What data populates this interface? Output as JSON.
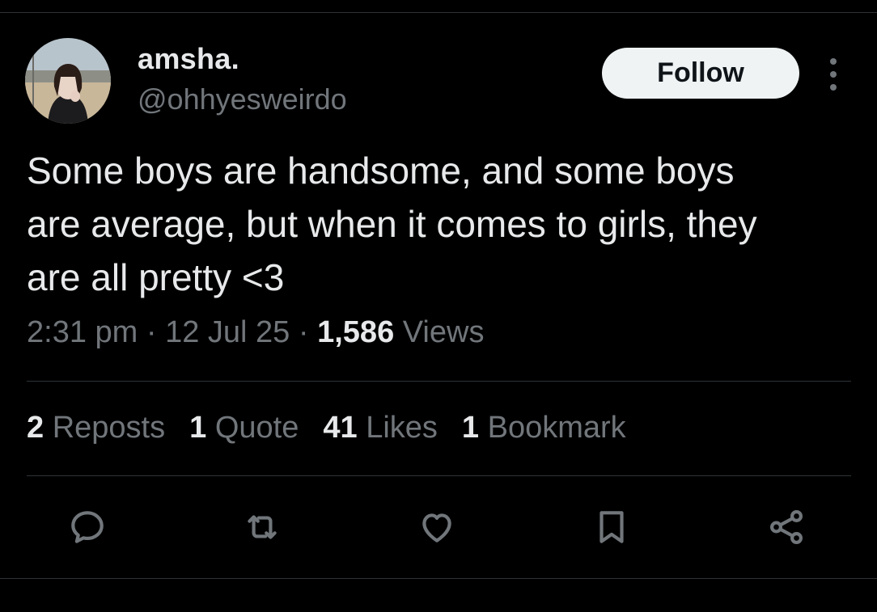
{
  "author": {
    "display_name": "amsha.",
    "handle": "@ohhyesweirdo"
  },
  "follow_label": "Follow",
  "tweet": {
    "text": "Some boys are handsome, and some boys\nare average, but when it comes to girls, they\nare all pretty <3",
    "time": "2:31 pm",
    "separator": " · ",
    "date": "12 Jul 25",
    "views_count": "1,586",
    "views_label": "Views"
  },
  "stats": {
    "reposts": {
      "count": "2",
      "label": "Reposts"
    },
    "quotes": {
      "count": "1",
      "label": "Quote"
    },
    "likes": {
      "count": "41",
      "label": "Likes"
    },
    "bookmarks": {
      "count": "1",
      "label": "Bookmark"
    }
  },
  "actions": [
    "reply-icon",
    "repost-icon",
    "like-icon",
    "bookmark-icon",
    "share-icon"
  ],
  "colors": {
    "background": "#000000",
    "text": "#e7e9ea",
    "secondary": "#71767b",
    "divider": "#2f3336",
    "follow_bg": "#eff3f4"
  }
}
